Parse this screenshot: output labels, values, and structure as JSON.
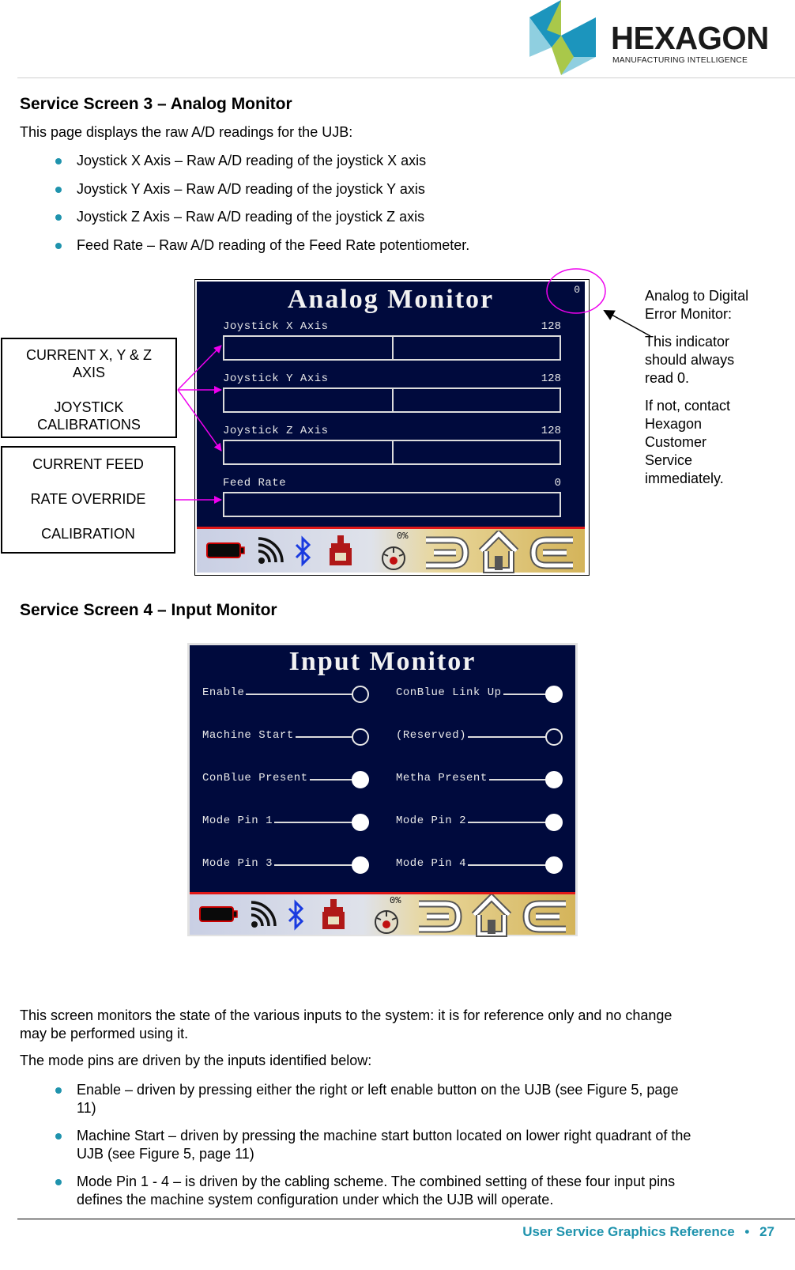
{
  "logo": {
    "wordmark": "HEXAGON",
    "tagline": "MANUFACTURING INTELLIGENCE",
    "colors": {
      "blue": "#1c95bd",
      "light_blue": "#8fcfe0",
      "green": "#a9c84a"
    }
  },
  "section1": {
    "heading": "Service Screen 3 – Analog Monitor",
    "intro": "This page displays the raw A/D readings for the UJB:",
    "bullets": [
      "Joystick X Axis – Raw A/D reading of the joystick X axis",
      "Joystick Y Axis – Raw A/D reading of the joystick Y axis",
      "Joystick Z Axis – Raw A/D reading of the joystick Z axis",
      "Feed Rate – Raw A/D reading of the Feed Rate potentiometer."
    ]
  },
  "analog_screen": {
    "title": "Analog Monitor",
    "error_indicator": "0",
    "rows": [
      {
        "label": "Joystick X Axis",
        "value": "128",
        "centered": true
      },
      {
        "label": "Joystick Y Axis",
        "value": "128",
        "centered": true
      },
      {
        "label": "Joystick Z Axis",
        "value": "128",
        "centered": true
      },
      {
        "label": "Feed Rate",
        "value": "0",
        "centered": false
      }
    ],
    "status": {
      "icons": [
        "battery-icon",
        "signal-icon",
        "bluetooth-icon",
        "machine-icon",
        "feed-gauge-icon",
        "menu-back-icon",
        "home-icon",
        "menu-forward-icon"
      ],
      "feed_percent": "0%"
    }
  },
  "callouts": {
    "joystick": {
      "line1": "CURRENT X, Y & Z",
      "line2": "AXIS",
      "line3": "JOYSTICK",
      "line4": "CALIBRATIONS"
    },
    "feed": {
      "line1": "CURRENT FEED",
      "line2": "RATE OVERRIDE",
      "line3": "CALIBRATION"
    },
    "error_note": {
      "title_line1": "Analog to Digital",
      "title_line2": "Error Monitor:",
      "p1_line1": "This indicator",
      "p1_line2": "should always",
      "p1_line3": "read 0.",
      "p2_line1": "If not, contact",
      "p2_line2": "Hexagon",
      "p2_line3": "Customer",
      "p2_line4": "Service",
      "p2_line5": "immediately."
    },
    "arrow_color": "#ee00ee"
  },
  "section2": {
    "heading": "Service Screen 4 – Input Monitor"
  },
  "input_screen": {
    "title": "Input Monitor",
    "left": [
      {
        "label": "Enable",
        "on": false
      },
      {
        "label": "Machine Start",
        "on": false
      },
      {
        "label": "ConBlue Present",
        "on": true
      },
      {
        "label": "Mode Pin 1",
        "on": true
      },
      {
        "label": "Mode Pin 3",
        "on": true
      }
    ],
    "right": [
      {
        "label": "ConBlue Link Up",
        "on": true
      },
      {
        "label": "(Reserved)",
        "on": false
      },
      {
        "label": "Metha Present",
        "on": true
      },
      {
        "label": "Mode Pin 2",
        "on": true
      },
      {
        "label": "Mode Pin 4",
        "on": true
      }
    ],
    "status": {
      "feed_percent": "0%"
    }
  },
  "body": {
    "p1_line1": "This screen monitors the state of the various inputs to the system: it is for reference only and no change",
    "p1_line2": "may be performed using it.",
    "p2": "The mode pins are driven by the inputs identified below:",
    "bullets": [
      {
        "line1": "Enable – driven by pressing either the right or left enable button on the UJB (see Figure 5, page",
        "line2": "11)"
      },
      {
        "line1": "Machine Start – driven by pressing the machine start button located on lower right quadrant of the",
        "line2": "UJB (see Figure 5, page 11)"
      },
      {
        "line1": "Mode Pin 1 - 4 – is driven by the cabling scheme.  The combined setting of these four input pins",
        "line2": "defines the machine system configuration under which the UJB will operate."
      }
    ]
  },
  "footer": {
    "title": "User Service Graphics Reference",
    "separator": "•",
    "page": "27"
  }
}
